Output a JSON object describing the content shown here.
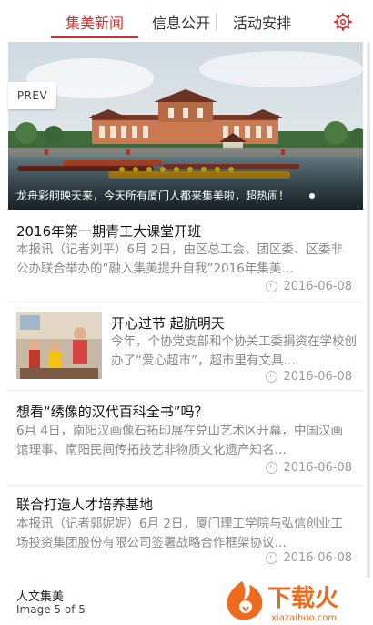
{
  "tabs": [
    {
      "label": "集美新闻",
      "active": true
    },
    {
      "label": "信息公开",
      "active": false
    },
    {
      "label": "活动安排",
      "active": false
    }
  ],
  "hero": {
    "prev_label": "PREV",
    "caption": "龙舟彩舸映天来，今天所有厦门人都来集美啦，超热闹！"
  },
  "news": [
    {
      "title": "2016年第一期青工大课堂开班",
      "desc": "本报讯（记者刘平）6月 2日，由区总工会、团区委、区委非公办联合举办的“融入集美提升自我”2016年集美…",
      "date": "2016-06-08",
      "has_thumb": false
    },
    {
      "title": "开心过节  起航明天",
      "desc": "今年，个协党支部和个协关工委捐资在学校创办了“爱心超市”，超市里有文具…",
      "date": "2016-06-08",
      "has_thumb": true
    },
    {
      "title": "想看“绣像的汉代百科全书”吗？",
      "desc": "6月 4日，南阳汉画像石拓印展在兑山艺术区开幕，中国汉画馆理事、南阳民间传拓技艺非物质文化遗产知名…",
      "date": "2016-06-08",
      "has_thumb": false
    },
    {
      "title": "联合打造人才培养基地",
      "desc": "本报讯（记者郭妮妮）6月 2日，厦门理工学院与弘信创业工场投资集团股份有限公司签署战略合作框架协议…",
      "date": "2016-06-08",
      "has_thumb": false
    }
  ],
  "bottom": {
    "title": "人文集美",
    "counter": "Image 5 of 5"
  },
  "watermark": {
    "brand": "下载火",
    "domain": "xiazaihuo.com"
  },
  "colors": {
    "accent": "#d2302c",
    "watermark": "#f06a1e"
  }
}
